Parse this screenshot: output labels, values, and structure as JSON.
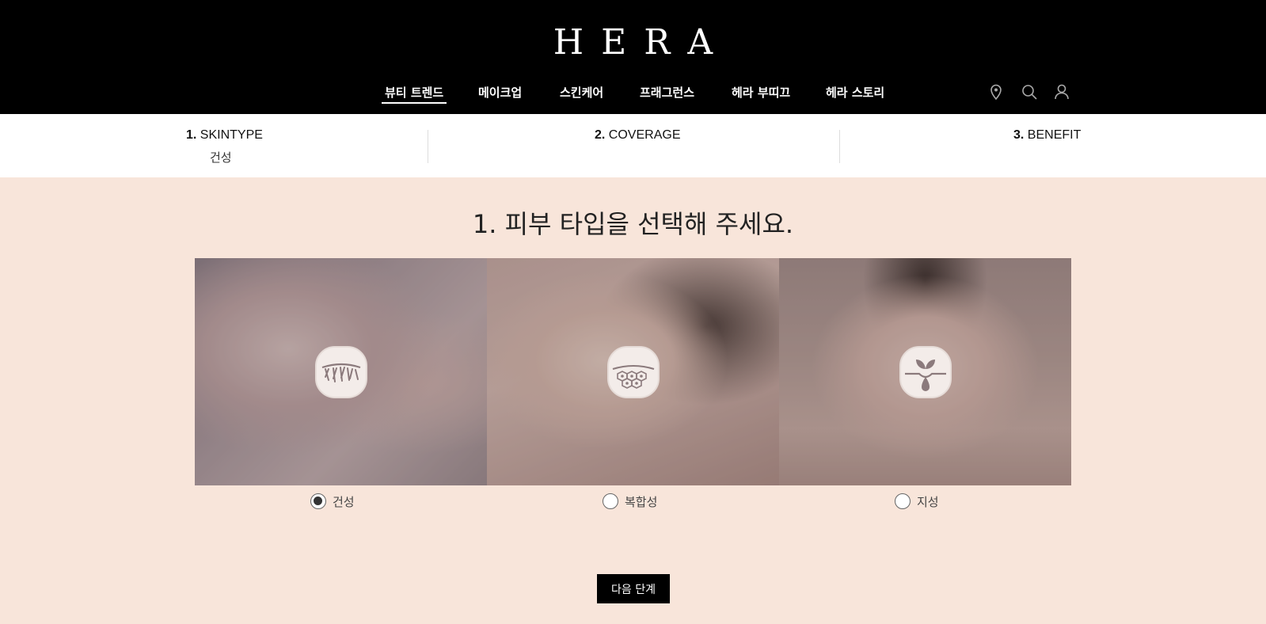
{
  "header": {
    "logo": "HERA",
    "nav": [
      {
        "label": "뷰티 트렌드",
        "active": true
      },
      {
        "label": "메이크업",
        "active": false
      },
      {
        "label": "스킨케어",
        "active": false
      },
      {
        "label": "프래그런스",
        "active": false
      },
      {
        "label": "헤라 부띠끄",
        "active": false
      },
      {
        "label": "헤라 스토리",
        "active": false
      }
    ],
    "icons": [
      "location-pin-icon",
      "search-icon",
      "user-icon"
    ]
  },
  "steps": [
    {
      "num": "1.",
      "name": "SKINTYPE",
      "value": "건성"
    },
    {
      "num": "2.",
      "name": "COVERAGE",
      "value": ""
    },
    {
      "num": "3.",
      "name": "BENEFIT",
      "value": ""
    }
  ],
  "main": {
    "title": "1. 피부 타입을 선택해 주세요.",
    "options": [
      {
        "label": "건성",
        "checked": true,
        "icon": "dry-skin-icon"
      },
      {
        "label": "복합성",
        "checked": false,
        "icon": "combination-skin-icon"
      },
      {
        "label": "지성",
        "checked": false,
        "icon": "oily-skin-icon"
      }
    ],
    "next_label": "다음 단계"
  },
  "colors": {
    "header_bg": "#000000",
    "page_bg": "#f8e5da",
    "accent": "#000000"
  }
}
